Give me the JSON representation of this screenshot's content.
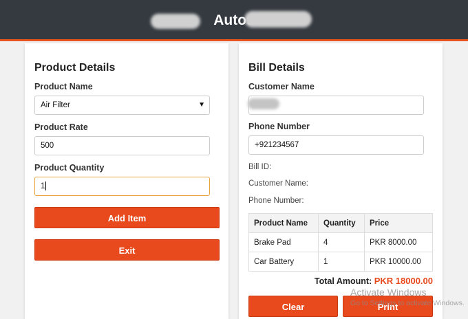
{
  "header": {
    "title": "Autos"
  },
  "product": {
    "heading": "Product Details",
    "name_label": "Product Name",
    "name_value": "Air Filter",
    "rate_label": "Product Rate",
    "rate_value": "500",
    "qty_label": "Product Quantity",
    "qty_value": "1",
    "add_label": "Add Item",
    "exit_label": "Exit"
  },
  "bill": {
    "heading": "Bill Details",
    "customer_label": "Customer Name",
    "phone_label": "Phone Number",
    "phone_value": "+921234567",
    "bill_id_label": "Bill ID:",
    "customer_name_label": "Customer Name:",
    "phone_number_label": "Phone Number:",
    "table": {
      "headers": [
        "Product Name",
        "Quantity",
        "Price"
      ],
      "rows": [
        [
          "Brake Pad",
          "4",
          "PKR 8000.00"
        ],
        [
          "Car Battery",
          "1",
          "PKR 10000.00"
        ]
      ]
    },
    "total_label": "Total Amount:",
    "total_value": "PKR 18000.00",
    "clear_label": "Clear",
    "print_label": "Print"
  },
  "watermark": {
    "line1": "Activate Windows",
    "line2": "Go to Settings to activate Windows."
  },
  "colors": {
    "accent": "#e8491d",
    "header_bg": "#343a40"
  }
}
